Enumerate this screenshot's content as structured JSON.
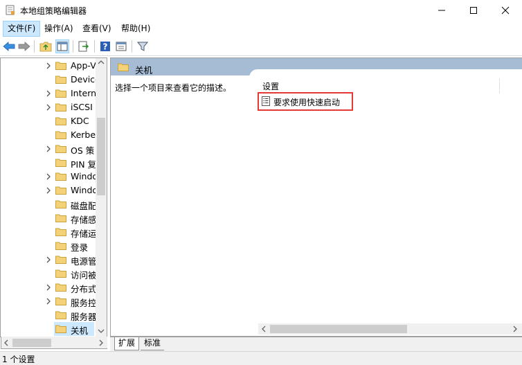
{
  "window": {
    "title": "本地组策略编辑器",
    "controls": {
      "minimize": "—",
      "maximize": "☐",
      "close": "✕"
    }
  },
  "menu": [
    {
      "label": "文件(F)"
    },
    {
      "label": "操作(A)"
    },
    {
      "label": "查看(V)"
    },
    {
      "label": "帮助(H)"
    }
  ],
  "toolbar": {
    "icons": [
      "back-arrow-icon",
      "forward-arrow-icon",
      "folder-up-icon",
      "show-hide-tree-icon",
      "export-list-icon",
      "help-icon",
      "properties-icon",
      "filter-icon"
    ]
  },
  "tree": {
    "items": [
      {
        "label": "App-V",
        "expandable": true
      },
      {
        "label": "Device",
        "expandable": false
      },
      {
        "label": "Intern",
        "expandable": true
      },
      {
        "label": "iSCSI",
        "expandable": true
      },
      {
        "label": "KDC",
        "expandable": false
      },
      {
        "label": "Kerbe",
        "expandable": false
      },
      {
        "label": "OS 策",
        "expandable": true
      },
      {
        "label": "PIN 复",
        "expandable": false
      },
      {
        "label": "Windo",
        "expandable": true
      },
      {
        "label": "Windo",
        "expandable": true
      },
      {
        "label": "磁盘配",
        "expandable": false
      },
      {
        "label": "存储感",
        "expandable": false
      },
      {
        "label": "存储运",
        "expandable": false
      },
      {
        "label": "登录",
        "expandable": false
      },
      {
        "label": "电源管",
        "expandable": true
      },
      {
        "label": "访问被",
        "expandable": false
      },
      {
        "label": "分布式",
        "expandable": true
      },
      {
        "label": "服务控",
        "expandable": true
      },
      {
        "label": "服务器",
        "expandable": false
      },
      {
        "label": "关机",
        "expandable": false,
        "selected": true
      }
    ]
  },
  "details": {
    "folder_title": "关机",
    "description": "选择一个项目来查看它的描述。",
    "column_header": "设置",
    "settings": [
      {
        "label": "要求使用快速启动"
      }
    ]
  },
  "tabs": [
    {
      "label": "扩展",
      "active": true
    },
    {
      "label": "标准",
      "active": false
    }
  ],
  "status": {
    "text": "1 个设置"
  },
  "colors": {
    "header_band": "#a6bcd4",
    "selection": "#cce8ff",
    "highlight_box": "#e53935",
    "folder": "#f4d27a"
  }
}
